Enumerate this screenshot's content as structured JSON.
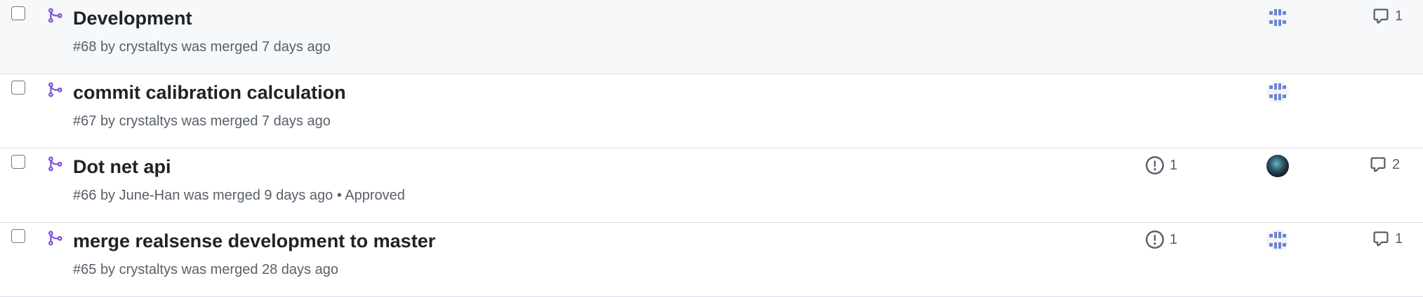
{
  "pull_requests": [
    {
      "title": "Development",
      "number": "#68",
      "meta_text": "by crystaltys was merged 7 days ago",
      "status_icon": "git-merge-icon",
      "linked_issues": "",
      "comments": "1",
      "avatar": "identicon",
      "approved": ""
    },
    {
      "title": "commit calibration calculation",
      "number": "#67",
      "meta_text": "by crystaltys was merged 7 days ago",
      "status_icon": "git-merge-icon",
      "linked_issues": "",
      "comments": "",
      "avatar": "identicon",
      "approved": ""
    },
    {
      "title": "Dot net api",
      "number": "#66",
      "meta_text": "by June-Han was merged 9 days ago",
      "status_icon": "git-merge-icon",
      "linked_issues": "1",
      "comments": "2",
      "avatar": "photo",
      "approved": "• Approved"
    },
    {
      "title": "merge realsense development to master",
      "number": "#65",
      "meta_text": "by crystaltys was merged 28 days ago",
      "status_icon": "git-merge-icon",
      "linked_issues": "1",
      "comments": "1",
      "avatar": "identicon",
      "approved": ""
    }
  ],
  "colors": {
    "merged": "#8250df",
    "muted": "#57606a",
    "hover_bg": "#f6f8fa",
    "border": "#d8dee4",
    "identicon": "#6c84d4"
  }
}
